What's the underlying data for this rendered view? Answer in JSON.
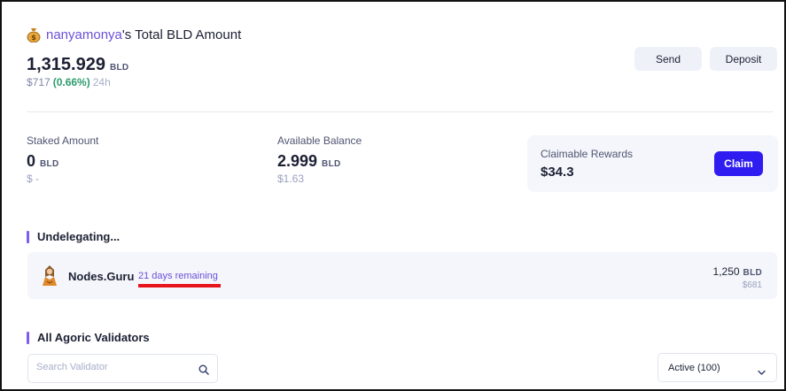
{
  "header": {
    "owner": "nanyamonya",
    "title_suffix": "'s Total BLD Amount",
    "total_amount": "1,315.929",
    "unit": "BLD",
    "fiat": "$717",
    "change": "(0.66%)",
    "period": "24h"
  },
  "actions": {
    "send_label": "Send",
    "deposit_label": "Deposit"
  },
  "stats": {
    "staked": {
      "label": "Staked Amount",
      "value": "0",
      "unit": "BLD",
      "fiat": "$ -"
    },
    "available": {
      "label": "Available Balance",
      "value": "2.999",
      "unit": "BLD",
      "fiat": "$1.63"
    },
    "rewards": {
      "label": "Claimable Rewards",
      "value": "$34.3",
      "claim_label": "Claim"
    }
  },
  "undelegating": {
    "title": "Undelegating...",
    "items": [
      {
        "validator": "Nodes.Guru",
        "remaining": "21 days remaining",
        "amount": "1,250",
        "unit": "BLD",
        "fiat": "$681"
      }
    ]
  },
  "validators": {
    "title": "All Agoric Validators",
    "search_placeholder": "Search Validator",
    "filter_selected": "Active (100)"
  },
  "icons": {
    "title_icon": "money-bag-icon",
    "validator_logo": "nodes-guru-logo-icon",
    "search": "search-icon",
    "dropdown": "chevron-down-icon"
  },
  "colors": {
    "accent": "#6c4fd8",
    "primary_button": "#2f1cf0",
    "positive": "#2d9b6e",
    "annotation_underline": "#e8141c"
  }
}
